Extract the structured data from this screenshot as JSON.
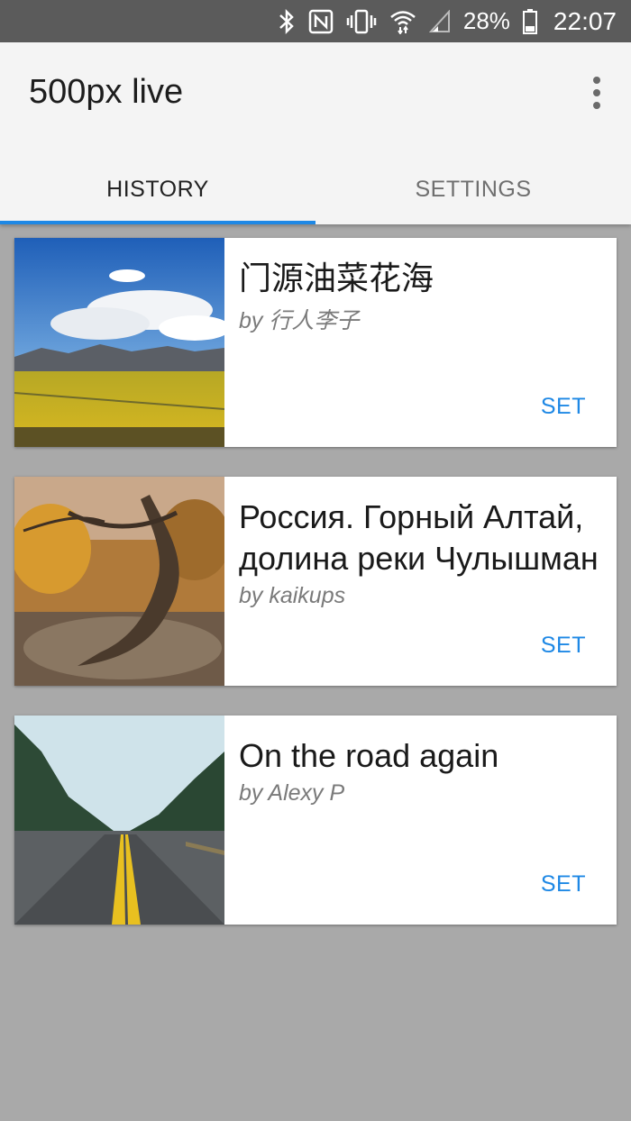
{
  "status_bar": {
    "battery_percent": "28%",
    "time": "22:07",
    "icons": [
      "bluetooth-icon",
      "nfc-icon",
      "vibrate-icon",
      "wifi-icon",
      "cell-signal-icon",
      "battery-icon"
    ]
  },
  "app_bar": {
    "title": "500px live",
    "menu_icon": "overflow-menu-icon"
  },
  "tabs": [
    {
      "label": "HISTORY",
      "active": true
    },
    {
      "label": "SETTINGS",
      "active": false
    }
  ],
  "colors": {
    "accent": "#1e88e5",
    "background": "#a9a9a9",
    "status_bar": "#5b5b5b",
    "app_bar": "#f4f4f4"
  },
  "cards": [
    {
      "title": "门源油菜花海",
      "author": "by 行人李子",
      "action": "SET",
      "thumbnail": "landscape-yellow-field"
    },
    {
      "title": "Россия. Горный Алтай, долина реки Чулышман",
      "author": "by kaikups",
      "action": "SET",
      "thumbnail": "autumn-tree"
    },
    {
      "title": "On the road again",
      "author": "by Alexy P",
      "action": "SET",
      "thumbnail": "forest-road"
    }
  ]
}
